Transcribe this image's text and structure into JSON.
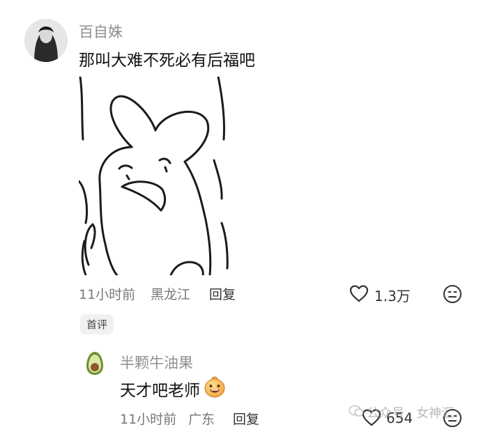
{
  "comments": [
    {
      "username": "百自姝",
      "text": "那叫大难不死必有后福吧",
      "time": "11小时前",
      "location": "黑龙江",
      "reply_label": "回复",
      "like_count": "1.3万",
      "tag": "首评"
    },
    {
      "username": "半颗牛油果",
      "text": "天才吧老师",
      "time": "11小时前",
      "location": "广东",
      "reply_label": "回复",
      "like_count": "654"
    }
  ],
  "watermark": "公众号 · 女神汇"
}
